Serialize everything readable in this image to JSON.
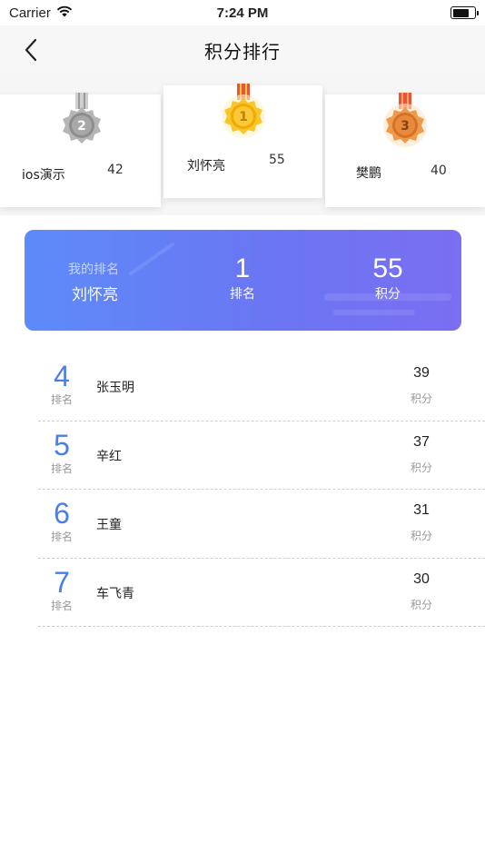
{
  "status_bar": {
    "carrier": "Carrier",
    "time": "7:24 PM"
  },
  "nav": {
    "title": "积分排行"
  },
  "podium": {
    "second": {
      "medal": "2",
      "name": "ios演示",
      "score": "42"
    },
    "first": {
      "medal": "1",
      "name": "刘怀亮",
      "score": "55"
    },
    "third": {
      "medal": "3",
      "name": "樊鹏",
      "score": "40"
    }
  },
  "my_rank": {
    "label": "我的排名",
    "name": "刘怀亮",
    "rank": "1",
    "rank_label": "排名",
    "score": "55",
    "score_label": "积分"
  },
  "list": [
    {
      "rank": "4",
      "rank_label": "排名",
      "name": "张玉明",
      "score": "39",
      "score_label": "积分"
    },
    {
      "rank": "5",
      "rank_label": "排名",
      "name": "辛红",
      "score": "37",
      "score_label": "积分"
    },
    {
      "rank": "6",
      "rank_label": "排名",
      "name": "王童",
      "score": "31",
      "score_label": "积分"
    },
    {
      "rank": "7",
      "rank_label": "排名",
      "name": "车飞青",
      "score": "30",
      "score_label": "积分"
    }
  ],
  "colors": {
    "accent": "#4a7ee8",
    "card_gradient_start": "#5d8bf9",
    "card_gradient_end": "#7a6ef2",
    "gold": "#f5b820",
    "silver": "#9a9a9a",
    "bronze": "#e08a3a"
  }
}
